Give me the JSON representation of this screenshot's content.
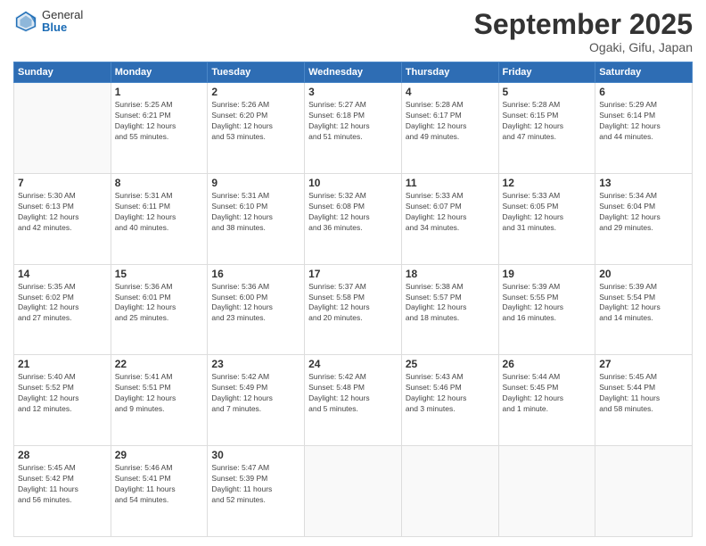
{
  "header": {
    "logo_general": "General",
    "logo_blue": "Blue",
    "month_title": "September 2025",
    "subtitle": "Ogaki, Gifu, Japan"
  },
  "days_of_week": [
    "Sunday",
    "Monday",
    "Tuesday",
    "Wednesday",
    "Thursday",
    "Friday",
    "Saturday"
  ],
  "weeks": [
    [
      {
        "day": "",
        "info": ""
      },
      {
        "day": "1",
        "info": "Sunrise: 5:25 AM\nSunset: 6:21 PM\nDaylight: 12 hours\nand 55 minutes."
      },
      {
        "day": "2",
        "info": "Sunrise: 5:26 AM\nSunset: 6:20 PM\nDaylight: 12 hours\nand 53 minutes."
      },
      {
        "day": "3",
        "info": "Sunrise: 5:27 AM\nSunset: 6:18 PM\nDaylight: 12 hours\nand 51 minutes."
      },
      {
        "day": "4",
        "info": "Sunrise: 5:28 AM\nSunset: 6:17 PM\nDaylight: 12 hours\nand 49 minutes."
      },
      {
        "day": "5",
        "info": "Sunrise: 5:28 AM\nSunset: 6:15 PM\nDaylight: 12 hours\nand 47 minutes."
      },
      {
        "day": "6",
        "info": "Sunrise: 5:29 AM\nSunset: 6:14 PM\nDaylight: 12 hours\nand 44 minutes."
      }
    ],
    [
      {
        "day": "7",
        "info": "Sunrise: 5:30 AM\nSunset: 6:13 PM\nDaylight: 12 hours\nand 42 minutes."
      },
      {
        "day": "8",
        "info": "Sunrise: 5:31 AM\nSunset: 6:11 PM\nDaylight: 12 hours\nand 40 minutes."
      },
      {
        "day": "9",
        "info": "Sunrise: 5:31 AM\nSunset: 6:10 PM\nDaylight: 12 hours\nand 38 minutes."
      },
      {
        "day": "10",
        "info": "Sunrise: 5:32 AM\nSunset: 6:08 PM\nDaylight: 12 hours\nand 36 minutes."
      },
      {
        "day": "11",
        "info": "Sunrise: 5:33 AM\nSunset: 6:07 PM\nDaylight: 12 hours\nand 34 minutes."
      },
      {
        "day": "12",
        "info": "Sunrise: 5:33 AM\nSunset: 6:05 PM\nDaylight: 12 hours\nand 31 minutes."
      },
      {
        "day": "13",
        "info": "Sunrise: 5:34 AM\nSunset: 6:04 PM\nDaylight: 12 hours\nand 29 minutes."
      }
    ],
    [
      {
        "day": "14",
        "info": "Sunrise: 5:35 AM\nSunset: 6:02 PM\nDaylight: 12 hours\nand 27 minutes."
      },
      {
        "day": "15",
        "info": "Sunrise: 5:36 AM\nSunset: 6:01 PM\nDaylight: 12 hours\nand 25 minutes."
      },
      {
        "day": "16",
        "info": "Sunrise: 5:36 AM\nSunset: 6:00 PM\nDaylight: 12 hours\nand 23 minutes."
      },
      {
        "day": "17",
        "info": "Sunrise: 5:37 AM\nSunset: 5:58 PM\nDaylight: 12 hours\nand 20 minutes."
      },
      {
        "day": "18",
        "info": "Sunrise: 5:38 AM\nSunset: 5:57 PM\nDaylight: 12 hours\nand 18 minutes."
      },
      {
        "day": "19",
        "info": "Sunrise: 5:39 AM\nSunset: 5:55 PM\nDaylight: 12 hours\nand 16 minutes."
      },
      {
        "day": "20",
        "info": "Sunrise: 5:39 AM\nSunset: 5:54 PM\nDaylight: 12 hours\nand 14 minutes."
      }
    ],
    [
      {
        "day": "21",
        "info": "Sunrise: 5:40 AM\nSunset: 5:52 PM\nDaylight: 12 hours\nand 12 minutes."
      },
      {
        "day": "22",
        "info": "Sunrise: 5:41 AM\nSunset: 5:51 PM\nDaylight: 12 hours\nand 9 minutes."
      },
      {
        "day": "23",
        "info": "Sunrise: 5:42 AM\nSunset: 5:49 PM\nDaylight: 12 hours\nand 7 minutes."
      },
      {
        "day": "24",
        "info": "Sunrise: 5:42 AM\nSunset: 5:48 PM\nDaylight: 12 hours\nand 5 minutes."
      },
      {
        "day": "25",
        "info": "Sunrise: 5:43 AM\nSunset: 5:46 PM\nDaylight: 12 hours\nand 3 minutes."
      },
      {
        "day": "26",
        "info": "Sunrise: 5:44 AM\nSunset: 5:45 PM\nDaylight: 12 hours\nand 1 minute."
      },
      {
        "day": "27",
        "info": "Sunrise: 5:45 AM\nSunset: 5:44 PM\nDaylight: 11 hours\nand 58 minutes."
      }
    ],
    [
      {
        "day": "28",
        "info": "Sunrise: 5:45 AM\nSunset: 5:42 PM\nDaylight: 11 hours\nand 56 minutes."
      },
      {
        "day": "29",
        "info": "Sunrise: 5:46 AM\nSunset: 5:41 PM\nDaylight: 11 hours\nand 54 minutes."
      },
      {
        "day": "30",
        "info": "Sunrise: 5:47 AM\nSunset: 5:39 PM\nDaylight: 11 hours\nand 52 minutes."
      },
      {
        "day": "",
        "info": ""
      },
      {
        "day": "",
        "info": ""
      },
      {
        "day": "",
        "info": ""
      },
      {
        "day": "",
        "info": ""
      }
    ]
  ]
}
